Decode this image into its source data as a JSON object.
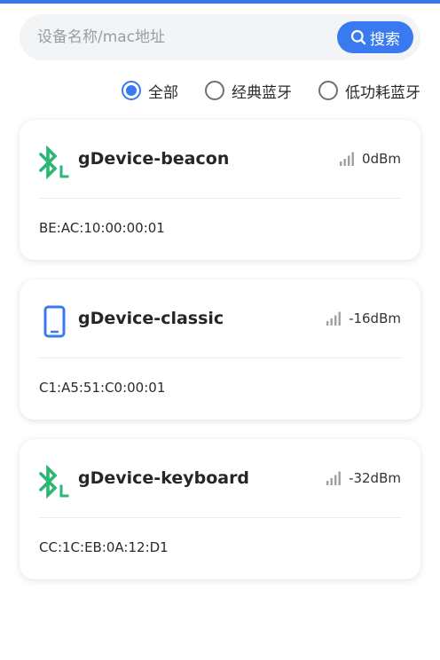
{
  "search": {
    "placeholder": "设备名称/mac地址",
    "button_label": "搜索"
  },
  "filters": [
    {
      "label": "全部",
      "checked": true
    },
    {
      "label": "经典蓝牙",
      "checked": false
    },
    {
      "label": "低功耗蓝牙",
      "checked": false
    }
  ],
  "devices": [
    {
      "name": "gDevice-beacon",
      "rssi": "0dBm",
      "mac": "BE:AC:10:00:00:01",
      "icon": "bluetooth-le-icon"
    },
    {
      "name": "gDevice-classic",
      "rssi": "-16dBm",
      "mac": "C1:A5:51:C0:00:01",
      "icon": "phone-icon"
    },
    {
      "name": "gDevice-keyboard",
      "rssi": "-32dBm",
      "mac": "CC:1C:EB:0A:12:D1",
      "icon": "bluetooth-le-icon"
    }
  ],
  "colors": {
    "accent": "#3a7af0",
    "bluetooth_green": "#2bb673",
    "phone_blue": "#3a7af0"
  }
}
